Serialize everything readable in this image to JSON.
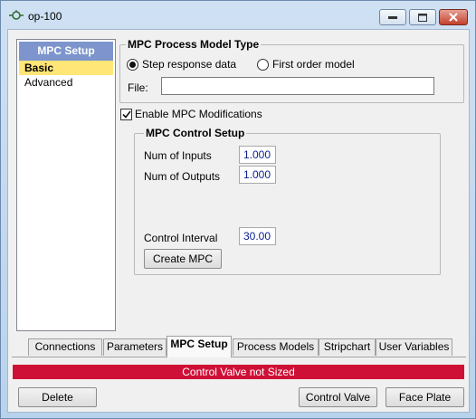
{
  "window": {
    "title": "op-100"
  },
  "sidebar": {
    "header": "MPC Setup",
    "items": [
      {
        "label": "Basic",
        "selected": true
      },
      {
        "label": "Advanced",
        "selected": false
      }
    ]
  },
  "process_model": {
    "group_title": "MPC Process Model Type",
    "radio_step": {
      "label": "Step response data",
      "checked": true
    },
    "radio_first_order": {
      "label": "First order model",
      "checked": false
    },
    "file_label": "File:",
    "file_value": ""
  },
  "enable_mods": {
    "label": "Enable MPC Modifications",
    "checked": true
  },
  "control_setup": {
    "group_title": "MPC Control Setup",
    "num_inputs_label": "Num of Inputs",
    "num_inputs_value": "1.000",
    "num_outputs_label": "Num of Outputs",
    "num_outputs_value": "1.000",
    "control_interval_label": "Control Interval",
    "control_interval_value": "30.00",
    "create_button": "Create MPC"
  },
  "tabs": [
    {
      "label": "Connections",
      "active": false
    },
    {
      "label": "Parameters",
      "active": false
    },
    {
      "label": "MPC Setup",
      "active": true
    },
    {
      "label": "Process Models",
      "active": false
    },
    {
      "label": "Stripchart",
      "active": false
    },
    {
      "label": "User Variables",
      "active": false
    }
  ],
  "status": {
    "text": "Control Valve not Sized",
    "color": "#cf1036"
  },
  "footer": {
    "delete": "Delete",
    "control_valve": "Control Valve",
    "face_plate": "Face Plate"
  }
}
